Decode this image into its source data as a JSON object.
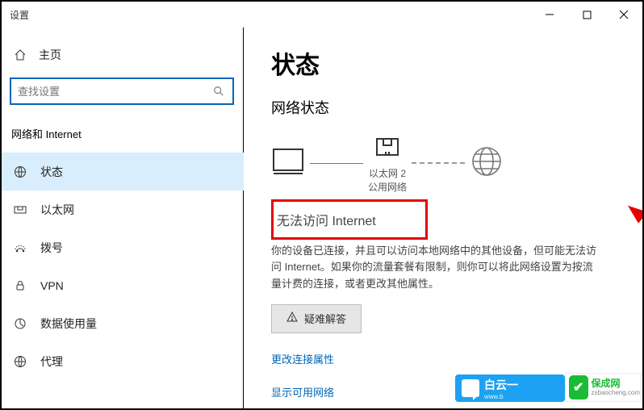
{
  "title": "设置",
  "sidebar": {
    "home": "主页",
    "search_placeholder": "查找设置",
    "category": "网络和 Internet",
    "items": [
      {
        "label": "状态"
      },
      {
        "label": "以太网"
      },
      {
        "label": "拨号"
      },
      {
        "label": "VPN"
      },
      {
        "label": "数据使用量"
      },
      {
        "label": "代理"
      }
    ]
  },
  "main": {
    "heading": "状态",
    "section": "网络状态",
    "adapter_name": "以太网 2",
    "adapter_type": "公用网络",
    "alert": "无法访问 Internet",
    "desc": "你的设备已连接，并且可以访问本地网络中的其他设备，但可能无法访问 Internet。如果你的流量套餐有限制，则你可以将此网络设置为按流量计费的连接，或者更改其他属性。",
    "troubleshoot": "疑难解答",
    "link_change": "更改连接属性",
    "link_show": "显示可用网络"
  },
  "watermarks": {
    "blue": "白云一",
    "blue_sub": "www.b",
    "green_top": "保成网",
    "green_sub": "zsbaocheng.com"
  }
}
